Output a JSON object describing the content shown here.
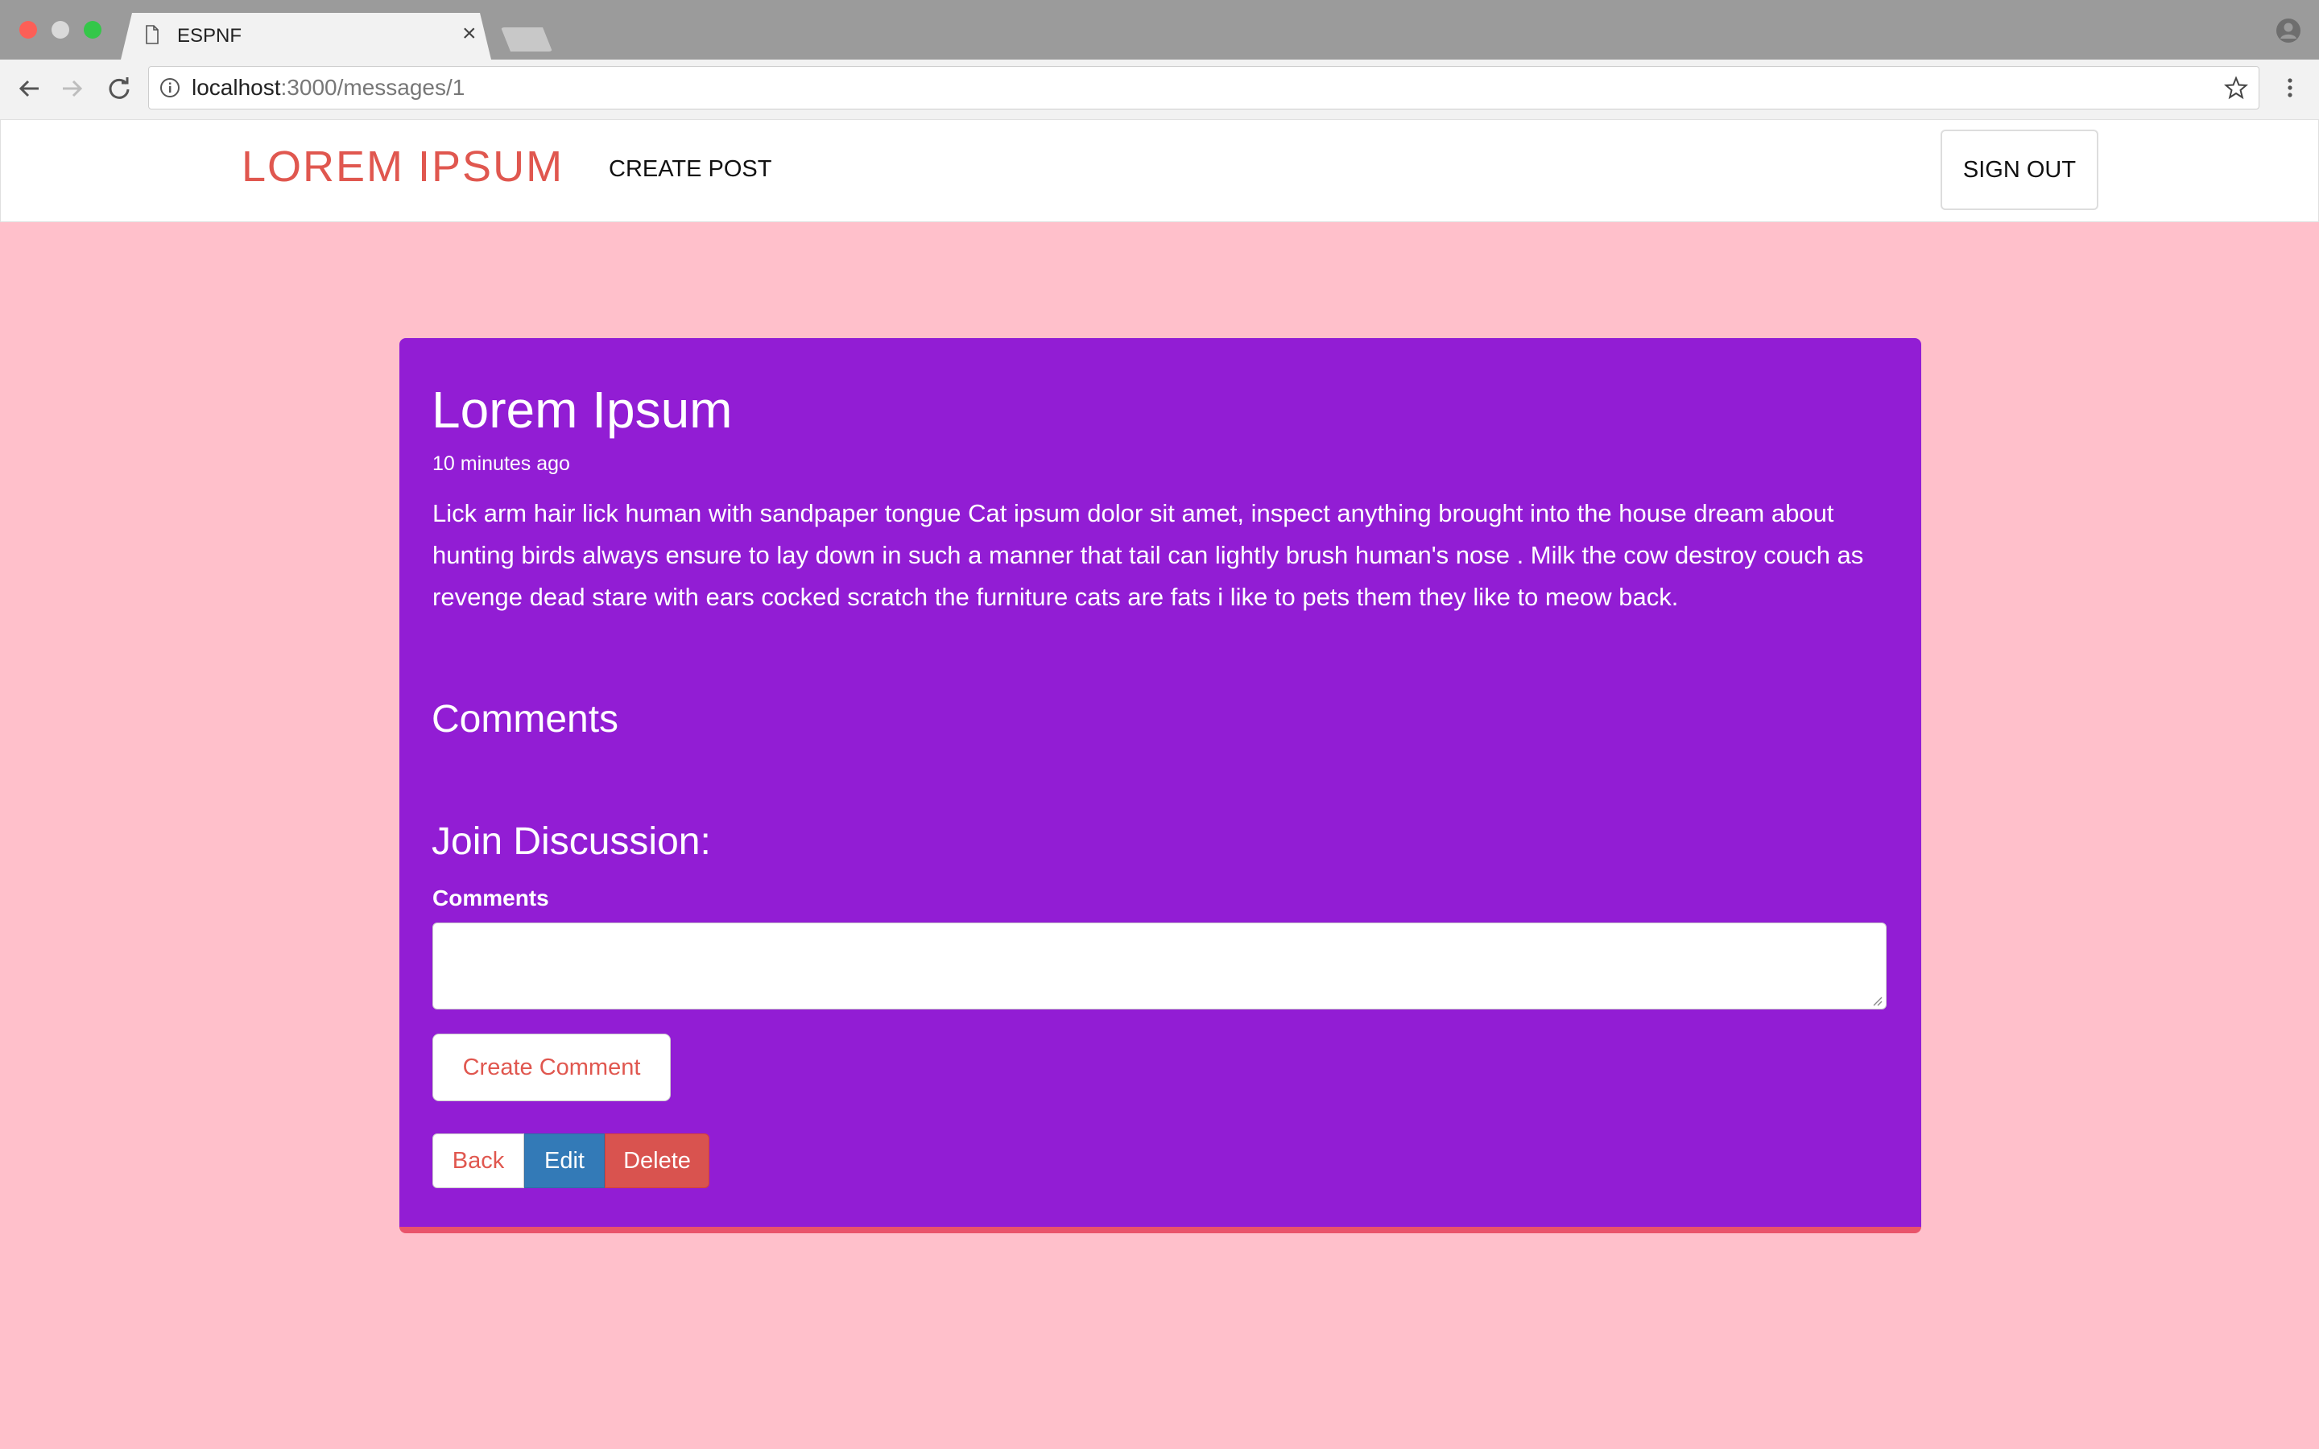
{
  "browser": {
    "tab_title": "ESPNF",
    "tab_close": "×",
    "url_host": "localhost",
    "url_path": ":3000/messages/1"
  },
  "navbar": {
    "brand": "LOREM IPSUM",
    "create_post": "CREATE POST",
    "sign_out": "SIGN OUT"
  },
  "post": {
    "title": "Lorem Ipsum",
    "timestamp": "10 minutes ago",
    "body": "Lick arm hair lick human with sandpaper tongue Cat ipsum dolor sit amet, inspect anything brought into the house dream about hunting birds always ensure to lay down in such a manner that tail can lightly brush human's nose . Milk the cow destroy couch as revenge dead stare with ears cocked scratch the furniture cats are fats i like to pets them they like to meow back."
  },
  "comments": {
    "heading": "Comments",
    "join_heading": "Join Discussion:",
    "field_label": "Comments",
    "field_value": "",
    "submit_label": "Create Comment"
  },
  "actions": {
    "back": "Back",
    "edit": "Edit",
    "delete": "Delete"
  },
  "colors": {
    "page_bg": "#ffc0cb",
    "card_bg": "#921dd4",
    "brand": "#e0574f",
    "edit_btn": "#337ab7",
    "delete_btn": "#d9534f"
  },
  "icons": [
    "close-icon",
    "back-arrow-icon",
    "forward-arrow-icon",
    "reload-icon",
    "info-icon",
    "star-icon",
    "menu-icon",
    "profile-icon",
    "page-icon"
  ]
}
